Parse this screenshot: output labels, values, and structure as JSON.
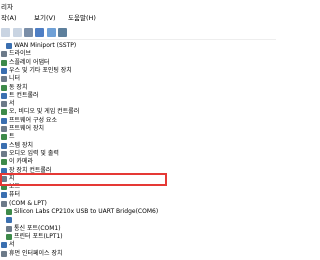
{
  "window": {
    "title": "리자"
  },
  "menu": {
    "items": [
      "작(A)",
      "보기(V)",
      "도움말(H)"
    ]
  },
  "tree": {
    "items": [
      {
        "label": "WAN Miniport (SSTP)",
        "kind": "device"
      },
      {
        "label": "드라이브",
        "kind": "category"
      },
      {
        "label": "스플레이 어댑터",
        "kind": "category"
      },
      {
        "label": "우스 및 기타 포인팅 장치",
        "kind": "category"
      },
      {
        "label": "니터",
        "kind": "category"
      },
      {
        "label": "동 장치",
        "kind": "category"
      },
      {
        "label": "트 컨트롤러",
        "kind": "category"
      },
      {
        "label": "서",
        "kind": "category"
      },
      {
        "label": "오, 비디오 및 게임 컨트롤러",
        "kind": "category"
      },
      {
        "label": "프트웨어 구성 요소",
        "kind": "category"
      },
      {
        "label": "프트웨어 장치",
        "kind": "category"
      },
      {
        "label": "트",
        "kind": "category"
      },
      {
        "label": "스템 장치",
        "kind": "category"
      },
      {
        "label": "오디오 입력 및 출력",
        "kind": "category"
      },
      {
        "label": "이 카메라",
        "kind": "category"
      },
      {
        "label": "장 장치 컨트롤러",
        "kind": "category"
      },
      {
        "label": "지",
        "kind": "category"
      },
      {
        "label": "보드",
        "kind": "category"
      },
      {
        "label": "퓨터",
        "kind": "category"
      },
      {
        "label": "(COM & LPT)",
        "kind": "category"
      },
      {
        "label": "Silicon Labs CP210x USB to UART Bridge(COM6)",
        "kind": "device"
      },
      {
        "label": "",
        "kind": "device"
      },
      {
        "label": "통신 포트(COM1)",
        "kind": "device"
      },
      {
        "label": "프린터 포트(LPT1)",
        "kind": "device"
      },
      {
        "label": "서",
        "kind": "category"
      },
      {
        "label": "휴먼 인터페이스 장치",
        "kind": "category"
      }
    ]
  },
  "colors": {
    "highlight": "#e53935",
    "icon_blue": "#3a6fb0",
    "icon_gray": "#6c7a89",
    "icon_green": "#3d8a4a"
  }
}
